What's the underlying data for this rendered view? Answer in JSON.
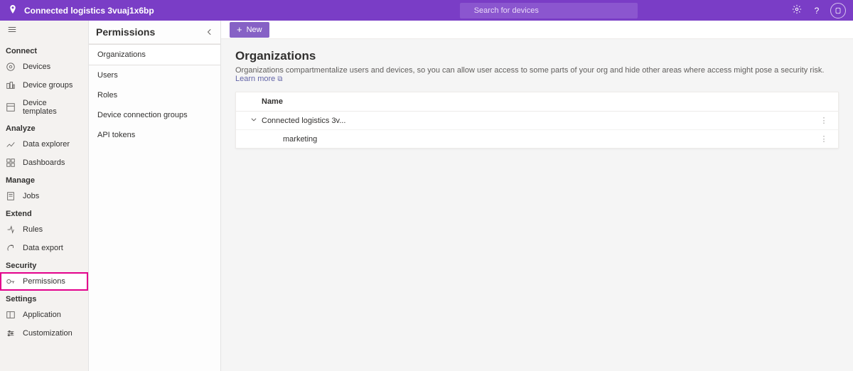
{
  "header": {
    "title": "Connected logistics 3vuaj1x6bp",
    "search_placeholder": "Search for devices"
  },
  "sidebar": {
    "sections": [
      {
        "label": "Connect",
        "items": [
          {
            "label": "Devices",
            "icon": "device-icon"
          },
          {
            "label": "Device groups",
            "icon": "groups-icon"
          },
          {
            "label": "Device templates",
            "icon": "template-icon"
          }
        ]
      },
      {
        "label": "Analyze",
        "items": [
          {
            "label": "Data explorer",
            "icon": "chart-icon"
          },
          {
            "label": "Dashboards",
            "icon": "dashboard-icon"
          }
        ]
      },
      {
        "label": "Manage",
        "items": [
          {
            "label": "Jobs",
            "icon": "jobs-icon"
          }
        ]
      },
      {
        "label": "Extend",
        "items": [
          {
            "label": "Rules",
            "icon": "rules-icon"
          },
          {
            "label": "Data export",
            "icon": "export-icon"
          }
        ]
      },
      {
        "label": "Security",
        "items": [
          {
            "label": "Permissions",
            "icon": "key-icon",
            "active": true,
            "highlight": true
          }
        ]
      },
      {
        "label": "Settings",
        "items": [
          {
            "label": "Application",
            "icon": "app-icon"
          },
          {
            "label": "Customization",
            "icon": "customize-icon"
          }
        ]
      }
    ]
  },
  "panel2": {
    "title": "Permissions",
    "items": [
      {
        "label": "Organizations",
        "active": true
      },
      {
        "label": "Users"
      },
      {
        "label": "Roles"
      },
      {
        "label": "Device connection groups"
      },
      {
        "label": "API tokens"
      }
    ]
  },
  "main": {
    "new_label": "New",
    "title": "Organizations",
    "description": "Organizations compartmentalize users and devices, so you can allow user access to some parts of your org and hide other areas where access might pose a security risk.",
    "learn_more": "Learn more",
    "table": {
      "header_name": "Name",
      "rows": [
        {
          "name": "Connected logistics 3v...",
          "expandable": true
        },
        {
          "name": "marketing",
          "child": true
        }
      ]
    }
  }
}
